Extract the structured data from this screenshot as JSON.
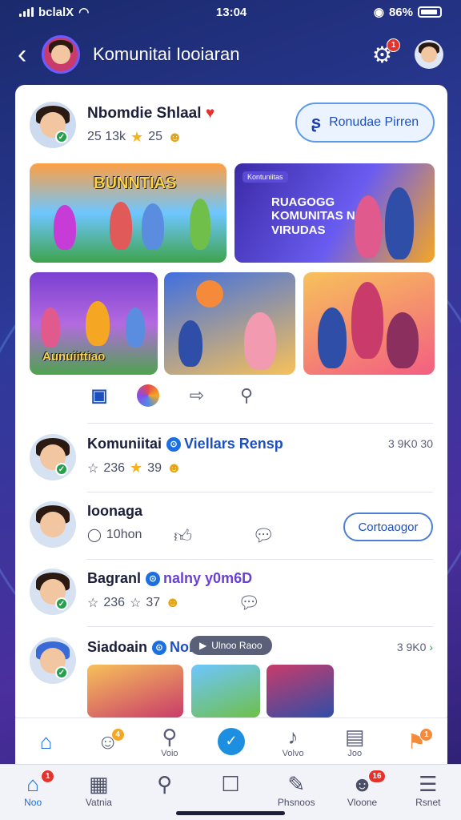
{
  "status": {
    "carrier": "bclalX",
    "time": "13:04",
    "battery": "86%"
  },
  "header": {
    "title": "Komunitai Iooiaran",
    "notif_count": "1"
  },
  "post": {
    "author": "Nbomdie Shlaal",
    "likes": "25 13k",
    "stars": "25",
    "follow_label": "Ronudae Pirren",
    "images": [
      {
        "caption": "BUNNTIAS"
      },
      {
        "tag": "Kontuniitas",
        "caption": "RUAGOGG KOMUNITAS N VIRUDAS"
      },
      {
        "caption": "Aunuiittiao"
      },
      {
        "caption": ""
      },
      {
        "caption": ""
      }
    ]
  },
  "comments": [
    {
      "name": "Komuniitai",
      "tag": "Viellars Rensp",
      "likes": "236",
      "stars": "39",
      "time": "3 9K0 30"
    },
    {
      "name": "Ioonaga",
      "replies": "10hon",
      "reply_label": "Cortoaogor"
    },
    {
      "name": "Bagranl",
      "tag": "nalny y0m6D",
      "likes": "236",
      "stars": "37"
    },
    {
      "name": "Siadoain",
      "tag": "Non",
      "pill": "Ulnoo Raoo",
      "time": "3 9K0"
    }
  ],
  "tabbar": [
    {
      "label": ""
    },
    {
      "label": "",
      "badge": "4"
    },
    {
      "label": "Voio"
    },
    {
      "label": ""
    },
    {
      "label": "Volvo"
    },
    {
      "label": "Joo"
    },
    {
      "label": "",
      "badge": "1"
    }
  ],
  "bottomnav": [
    {
      "label": "Noo",
      "badge": "1"
    },
    {
      "label": "Vatnia"
    },
    {
      "label": ""
    },
    {
      "label": ""
    },
    {
      "label": "Phsnoos"
    },
    {
      "label": "Vloone",
      "badge": "16"
    },
    {
      "label": "Rsnet"
    }
  ]
}
